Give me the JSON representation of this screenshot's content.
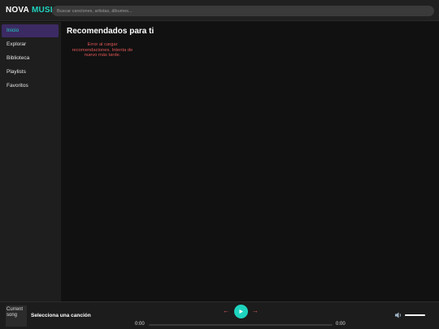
{
  "header": {
    "logo_part1": "NOVA",
    "logo_part2": "MUSIC",
    "search_placeholder": "Buscar canciones, artistas, álbumes...",
    "search_value": ""
  },
  "sidebar": {
    "items": [
      {
        "label": "Inicio",
        "active": true
      },
      {
        "label": "Explorar",
        "active": false
      },
      {
        "label": "Biblioteca",
        "active": false
      },
      {
        "label": "Playlists",
        "active": false
      },
      {
        "label": "Favoritos",
        "active": false
      }
    ]
  },
  "main": {
    "section_title": "Recomendados para ti",
    "error_message": "Error al cargar recomendaciones. Intenta de nuevo más tarde."
  },
  "player": {
    "cover_alt_line1": "Current",
    "cover_alt_line2": "song",
    "song_title": "Selecciona una canción",
    "prev_icon": "arrow-left-icon",
    "play_icon": "play-icon",
    "next_icon": "arrow-right-icon",
    "current_time": "0:00",
    "duration": "0:00",
    "progress_fraction": 0,
    "volume_icon": "speaker-icon",
    "volume_fraction": 1
  },
  "colors": {
    "accent": "#1ed4bf",
    "active_nav_bg": "#3c2a63",
    "error": "#e05555",
    "background": "#121212"
  }
}
